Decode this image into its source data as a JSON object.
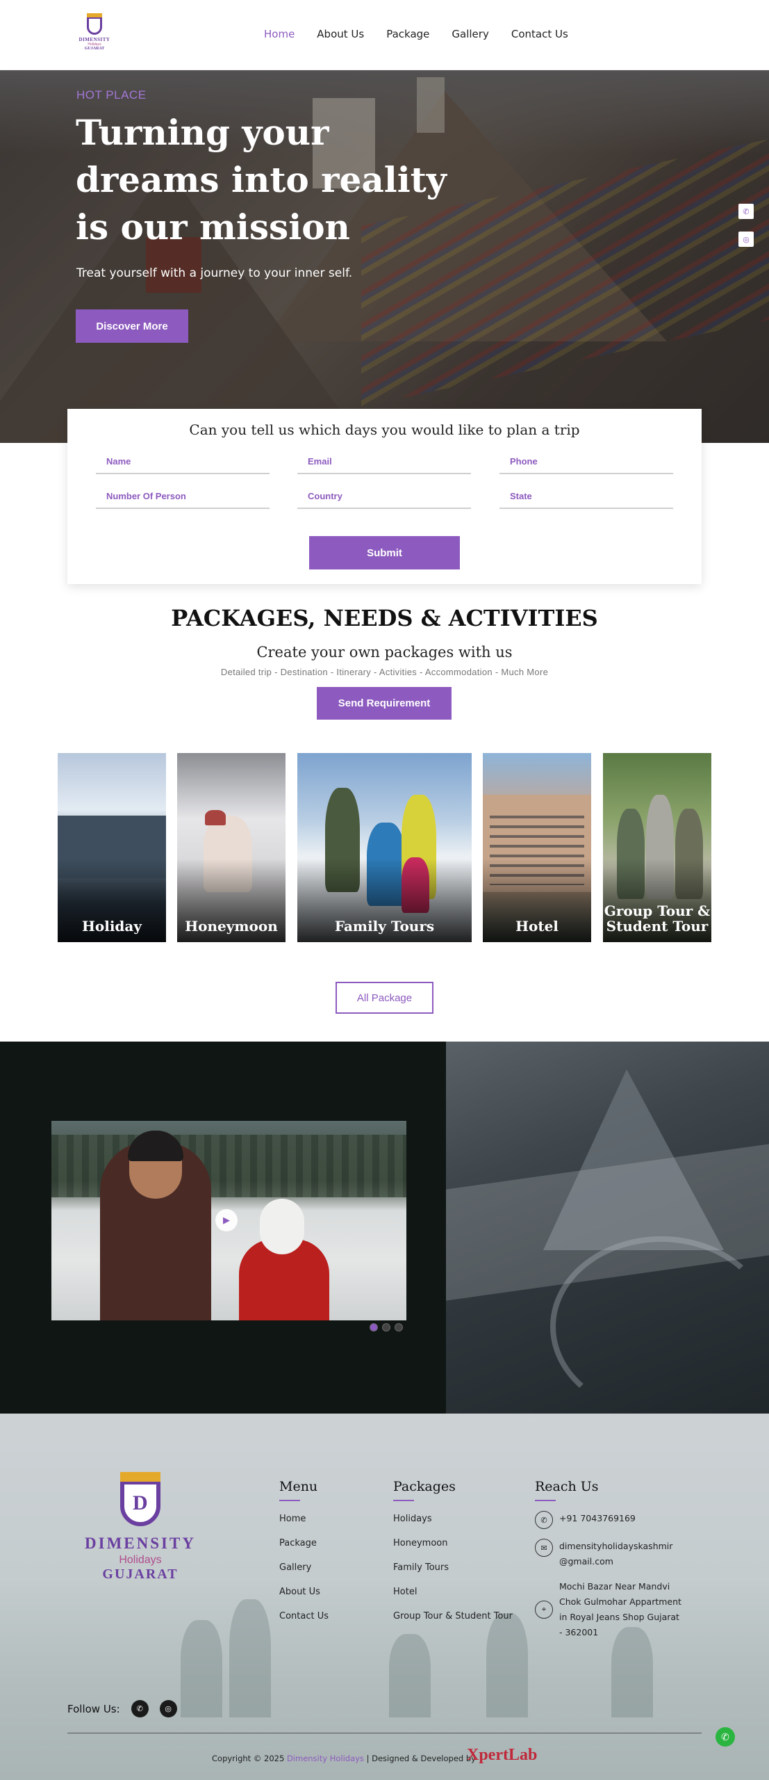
{
  "brand": {
    "line1": "DIMENSITY",
    "line2": "Holidays",
    "line3": "GUJARAT",
    "color": "#8d5bbf"
  },
  "nav": {
    "items": [
      "Home",
      "About Us",
      "Package",
      "Gallery",
      "Contact Us"
    ],
    "active": "Home"
  },
  "hero": {
    "eyebrow": "HOT PLACE",
    "title": "Turning your dreams into reality is our mission",
    "tagline": "Treat yourself with a journey to your inner self.",
    "cta": "Discover More"
  },
  "side_icons": [
    "whatsapp-icon",
    "instagram-icon"
  ],
  "trip_form": {
    "title": "Can you tell us which days you would like to plan a trip",
    "placeholders": {
      "name": "Name",
      "email": "Email",
      "phone": "Phone",
      "persons": "Number Of Person",
      "country": "Country",
      "state": "State"
    },
    "submit": "Submit"
  },
  "packages": {
    "heading": "PACKAGES, NEEDS & ACTIVITIES",
    "subheading": "Create your own packages with us",
    "details": "Detailed trip - Destination - Itinerary - Activities - Accommodation - Much More",
    "cta": "Send Requirement",
    "tiles": [
      "Holiday",
      "Honeymoon",
      "Family Tours",
      "Hotel",
      "Group Tour & Student Tour"
    ],
    "all_button": "All Package"
  },
  "video": {
    "slides": 3,
    "active_slide": 1
  },
  "footer": {
    "menu": {
      "title": "Menu",
      "items": [
        "Home",
        "Package",
        "Gallery",
        "About Us",
        "Contact Us"
      ]
    },
    "packages": {
      "title": "Packages",
      "items": [
        "Holidays",
        "Honeymoon",
        "Family Tours",
        "Hotel",
        "Group Tour & Student Tour"
      ]
    },
    "reach": {
      "title": "Reach Us",
      "phone": "+91 7043769169",
      "email": "dimensityholidayskashmir@gmail.com",
      "address": "Mochi Bazar Near Mandvi Chok Gulmohar Appartment in Royal Jeans Shop Gujarat - 362001"
    },
    "follow_label": "Follow Us:",
    "copyright_prefix": "Copyright © 2025",
    "copyright_brand": "Dimensity Holidays",
    "copyright_suffix": "| Designed & Developed by",
    "developer": "XpertLab"
  }
}
